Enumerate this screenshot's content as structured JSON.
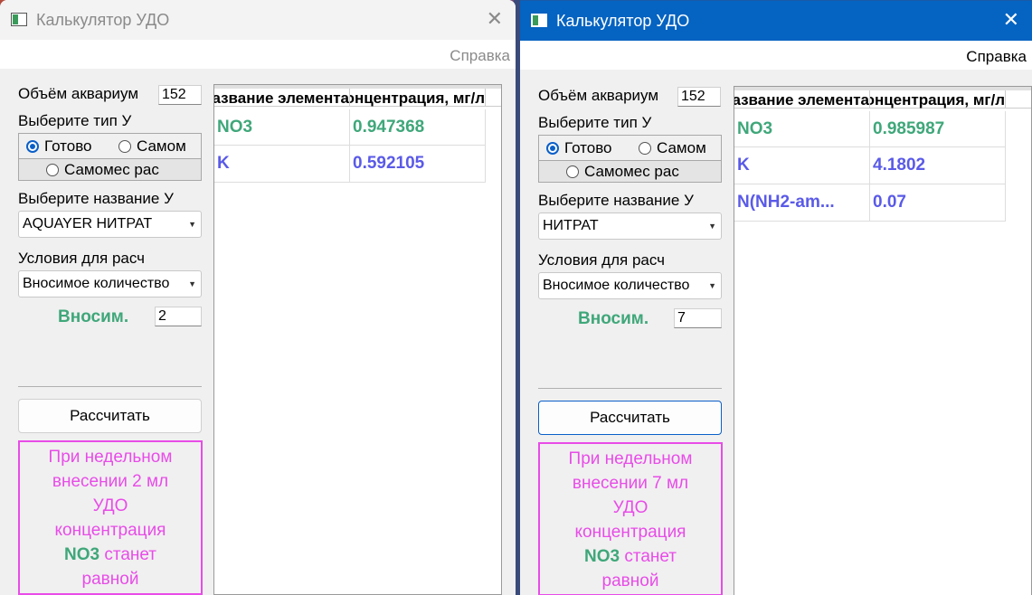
{
  "colors": {
    "accent_blue": "#0563c1",
    "element_green": "#3fa77a",
    "value_blue": "#5a5ae8",
    "result_pink": "#e84ce8"
  },
  "left": {
    "title": "Калькулятор УДО",
    "close": "✕",
    "menu_help": "Справка",
    "volume_label": "Объём аквариум",
    "volume_value": "152",
    "type_label": "Выберите тип У",
    "radio_ready": "Готово",
    "radio_self": "Самом",
    "radio_selfmix": "Самомес рас",
    "name_label": "Выберите название У",
    "name_value": "AQUAYER НИТРАТ",
    "cond_label": "Условия для расч",
    "cond_value": "Вносимое количество",
    "vnos_label": "Вносим.",
    "vnos_value": "2",
    "calc_button": "Рассчитать",
    "result": {
      "line1": "При недельном",
      "line2": "внесении 2 мл",
      "line3": "УДО",
      "line4": "концентрация",
      "element": "NO3",
      "line5_rest": " станет",
      "line6": "равной"
    },
    "table": {
      "col1": "Название элемента",
      "col2": "Концентрация, мг/л",
      "rows": [
        {
          "element": "NO3",
          "value": "0.947368"
        },
        {
          "element": "K",
          "value": "0.592105"
        }
      ]
    }
  },
  "right": {
    "title": "Калькулятор УДО",
    "close": "✕",
    "menu_help": "Справка",
    "volume_label": "Объём аквариум",
    "volume_value": "152",
    "type_label": "Выберите тип У",
    "radio_ready": "Готово",
    "radio_self": "Самом",
    "radio_selfmix": "Самомес рас",
    "name_label": "Выберите название У",
    "name_value": "НИТРАТ",
    "cond_label": "Условия для расч",
    "cond_value": "Вносимое количество",
    "vnos_label": "Вносим.",
    "vnos_value": "7",
    "calc_button": "Рассчитать",
    "result": {
      "line1": "При недельном",
      "line2": "внесении 7 мл",
      "line3": "УДО",
      "line4": "концентрация",
      "element": "NO3",
      "line5_rest": " станет",
      "line6": "равной"
    },
    "table": {
      "col1": "Название элемента",
      "col2": "Концентрация, мг/л",
      "rows": [
        {
          "element": "NO3",
          "value": "0.985987"
        },
        {
          "element": "K",
          "value": "4.1802"
        },
        {
          "element": "N(NH2-am...",
          "value": "0.07"
        }
      ]
    }
  }
}
